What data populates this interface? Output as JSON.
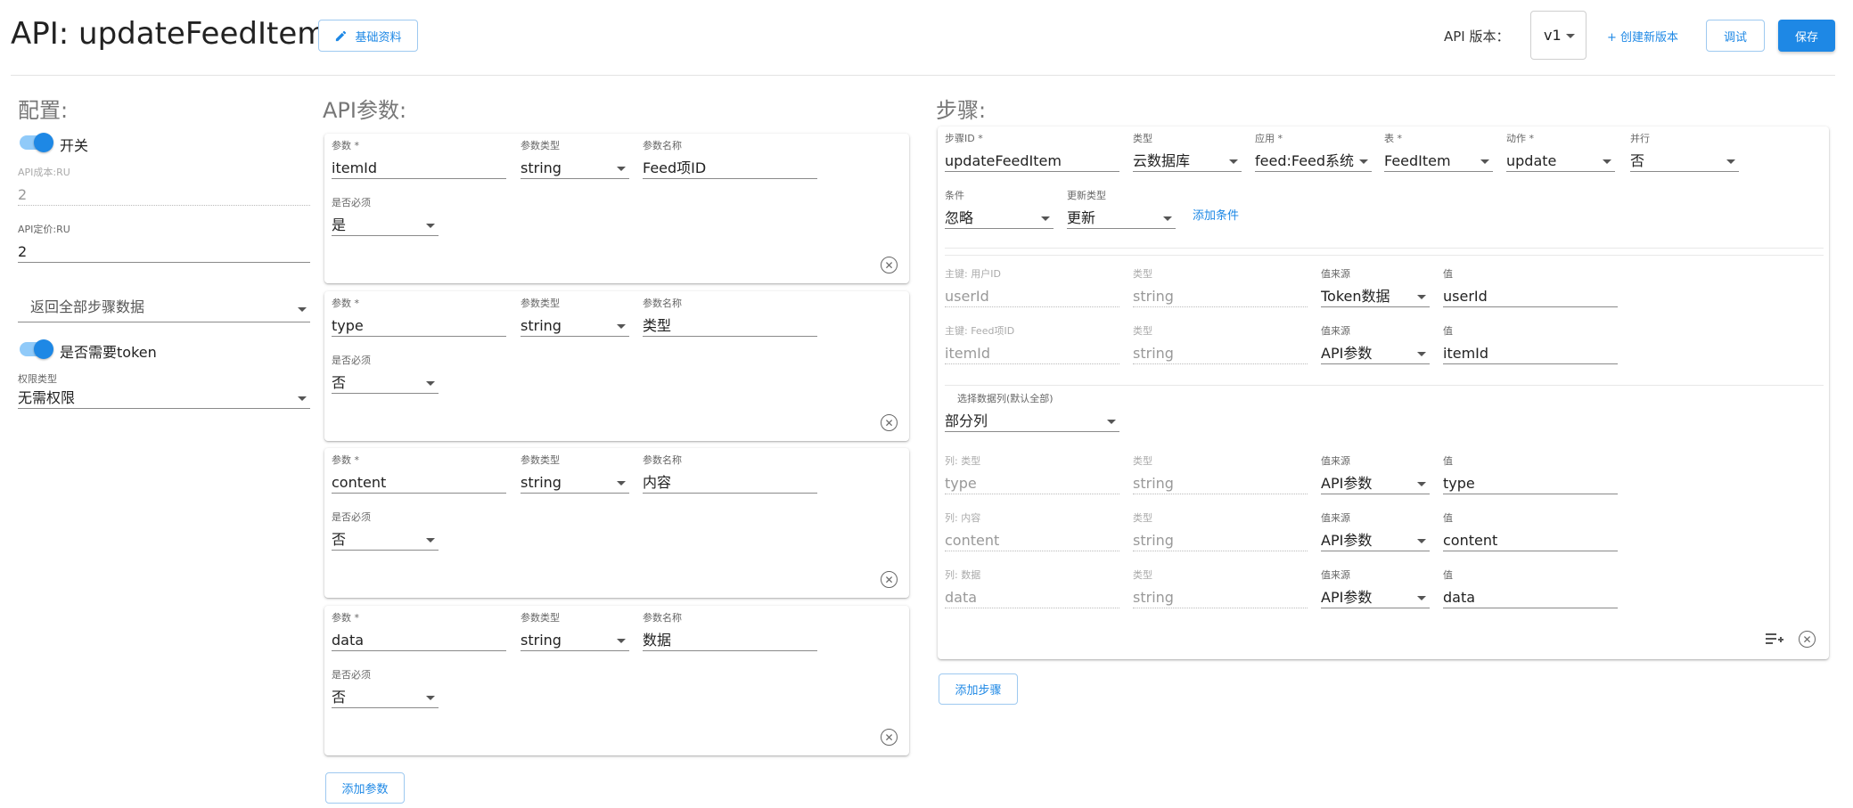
{
  "header": {
    "title": "API: updateFeedItem",
    "basic_info_label": "基础资料",
    "version_label": "API 版本：",
    "version_value": "v1",
    "create_version_label": "+ 创建新版本",
    "debug_label": "调试",
    "save_label": "保存"
  },
  "config": {
    "title": "配置:",
    "switch_label": "开关",
    "cost_label": "API成本:RU",
    "cost_value": "2",
    "price_label": "API定价:RU",
    "price_value": "2",
    "return_select": "返回全部步骤数据",
    "token_label": "是否需要token",
    "perm_label": "权限类型",
    "perm_value": "无需权限"
  },
  "params": {
    "title": "API参数:",
    "labels": {
      "param": "参数 *",
      "type": "参数类型",
      "name": "参数名称",
      "required": "是否必须"
    },
    "items": [
      {
        "param": "itemId",
        "type": "string",
        "name": "Feed项ID",
        "required": "是"
      },
      {
        "param": "type",
        "type": "string",
        "name": "类型",
        "required": "否"
      },
      {
        "param": "content",
        "type": "string",
        "name": "内容",
        "required": "否"
      },
      {
        "param": "data",
        "type": "string",
        "name": "数据",
        "required": "否"
      }
    ],
    "add_label": "添加参数"
  },
  "steps": {
    "title": "步骤:",
    "row1_labels": {
      "step_id": "步骤ID *",
      "type": "类型",
      "app": "应用 *",
      "table": "表 *",
      "action": "动作 *",
      "parallel": "并行"
    },
    "row1_values": {
      "step_id": "updateFeedItem",
      "type": "云数据库",
      "app": "feed:Feed系统",
      "table": "FeedItem",
      "action": "update",
      "parallel": "否"
    },
    "condition_label": "条件",
    "condition_value": "忽略",
    "update_type_label": "更新类型",
    "update_type_value": "更新",
    "add_condition": "添加条件",
    "keys": [
      {
        "key_label": "主键: 用户ID",
        "key_value": "userId",
        "type_label": "类型",
        "type_value": "string",
        "src_label": "值来源",
        "src_value": "Token数据",
        "val_label": "值",
        "val_value": "userId"
      },
      {
        "key_label": "主键: Feed项ID",
        "key_value": "itemId",
        "type_label": "类型",
        "type_value": "string",
        "src_label": "值来源",
        "src_value": "API参数",
        "val_label": "值",
        "val_value": "itemId"
      }
    ],
    "columns_label": "选择数据列(默认全部)",
    "columns_value": "部分列",
    "columns": [
      {
        "col_label": "列: 类型",
        "col_value": "type",
        "type_label": "类型",
        "type_value": "string",
        "src_label": "值来源",
        "src_value": "API参数",
        "val_label": "值",
        "val_value": "type"
      },
      {
        "col_label": "列: 内容",
        "col_value": "content",
        "type_label": "类型",
        "type_value": "string",
        "src_label": "值来源",
        "src_value": "API参数",
        "val_label": "值",
        "val_value": "content"
      },
      {
        "col_label": "列: 数据",
        "col_value": "data",
        "type_label": "类型",
        "type_value": "string",
        "src_label": "值来源",
        "src_value": "API参数",
        "val_label": "值",
        "val_value": "data"
      }
    ],
    "add_step": "添加步骤"
  },
  "colors": {
    "accent": "#1e88e5",
    "accent_light": "#90caf9"
  }
}
